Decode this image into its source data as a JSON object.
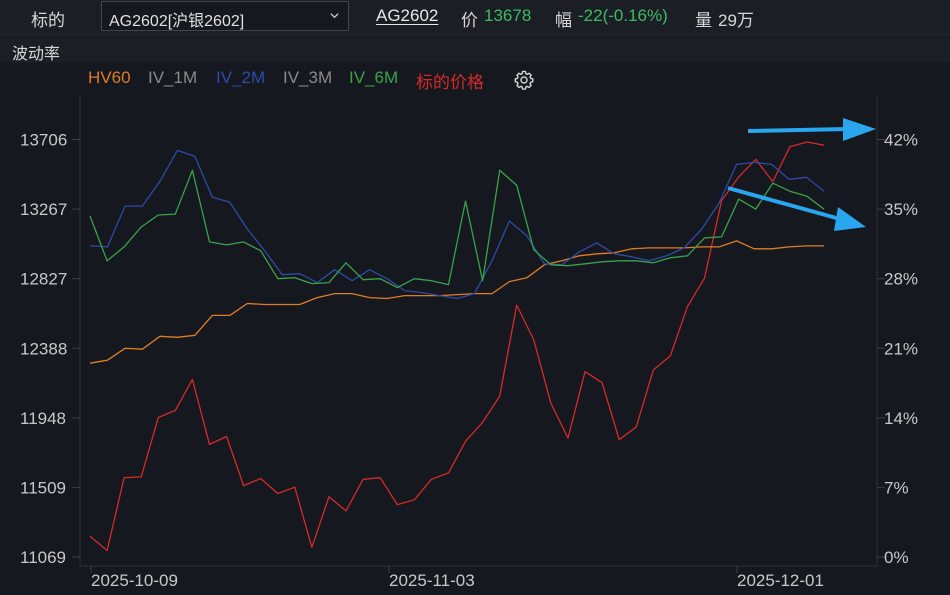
{
  "header": {
    "target_label": "标的",
    "select_value": "AG2602[沪银2602]",
    "symbol": "AG2602",
    "price_label": "价",
    "price_value": "13678",
    "change_label": "幅",
    "change_value": "-22(-0.16%)",
    "volume_label": "量",
    "volume_value": "29万"
  },
  "section_title": "波动率",
  "legend": [
    {
      "name": "HV60",
      "color": "#e07c24"
    },
    {
      "name": "IV_1M",
      "color": "#8a8a8a"
    },
    {
      "name": "IV_2M",
      "color": "#2f4aa6"
    },
    {
      "name": "IV_3M",
      "color": "#8a8a8a"
    },
    {
      "name": "IV_6M",
      "color": "#3aa24a"
    },
    {
      "name": "标的价格",
      "color": "#d62a2a"
    }
  ],
  "icons": {
    "settings": "gear-icon",
    "dropdown": "chevron-down-icon"
  },
  "chart_data": {
    "type": "line",
    "x_ticks": [
      "2025-10-09",
      "2025-11-03",
      "2025-12-01"
    ],
    "y_left_ticks": [
      "13706",
      "13267",
      "12827",
      "12388",
      "11948",
      "11509",
      "11069"
    ],
    "y_right_ticks": [
      "42%",
      "35%",
      "28%",
      "21%",
      "14%",
      "7%",
      "0%"
    ],
    "y_left_range": [
      11069,
      13706
    ],
    "y_right_range": [
      0,
      42
    ],
    "annotations": [
      "arrow-to-42%",
      "arrow-to-35%"
    ],
    "series": [
      {
        "name": "标的价格",
        "axis": "left",
        "color": "#d62a2a",
        "values": [
          11200,
          11110,
          11570,
          11575,
          11950,
          11995,
          12190,
          11780,
          11830,
          11520,
          11565,
          11470,
          11510,
          11130,
          11450,
          11360,
          11560,
          11570,
          11400,
          11430,
          11560,
          11600,
          11800,
          11920,
          12085,
          12660,
          12440,
          12040,
          11820,
          12240,
          12170,
          11810,
          11890,
          12250,
          12340,
          12650,
          12830,
          13320,
          13470,
          13580,
          13440,
          13660,
          13690,
          13670
        ]
      },
      {
        "name": "HV60",
        "axis": "right",
        "color": "#e07c24",
        "values": [
          19.5,
          19.8,
          21.0,
          20.9,
          22.2,
          22.1,
          22.3,
          24.3,
          24.3,
          25.5,
          25.4,
          25.4,
          25.4,
          26.1,
          26.5,
          26.5,
          26.1,
          26.0,
          26.3,
          26.3,
          26.3,
          26.4,
          26.5,
          26.5,
          27.7,
          28.1,
          29.4,
          29.8,
          30.3,
          30.5,
          30.6,
          31.0,
          31.1,
          31.1,
          31.1,
          31.2,
          31.2,
          31.8,
          31.0,
          31.0,
          31.2,
          31.3,
          31.3
        ]
      },
      {
        "name": "IV_2M",
        "axis": "right",
        "color": "#2f4aa6",
        "values": [
          31.3,
          31.2,
          35.3,
          35.3,
          37.8,
          40.9,
          40.3,
          36.2,
          35.7,
          33.0,
          30.8,
          28.4,
          28.5,
          27.6,
          28.9,
          27.8,
          28.9,
          28.0,
          26.8,
          26.6,
          26.3,
          26.0,
          26.5,
          29.8,
          33.8,
          32.3,
          29.5,
          29.4,
          30.7,
          31.6,
          30.5,
          30.2,
          29.8,
          30.3,
          31.1,
          33.0,
          35.6,
          39.5,
          39.7,
          39.5,
          38.0,
          38.2,
          36.8
        ]
      },
      {
        "name": "IV_6M",
        "axis": "right",
        "color": "#3aa24a",
        "values": [
          34.3,
          29.8,
          31.2,
          33.2,
          34.4,
          34.5,
          38.9,
          31.7,
          31.4,
          31.7,
          30.8,
          28.0,
          28.1,
          27.5,
          27.6,
          29.6,
          27.9,
          28.0,
          27.1,
          28.0,
          27.8,
          27.4,
          35.8,
          27.8,
          38.9,
          37.4,
          30.9,
          29.4,
          29.3,
          29.5,
          29.7,
          29.8,
          29.8,
          29.6,
          30.1,
          30.3,
          32.1,
          32.2,
          36.0,
          35.0,
          37.6,
          36.8,
          36.3,
          35.0
        ]
      }
    ]
  }
}
